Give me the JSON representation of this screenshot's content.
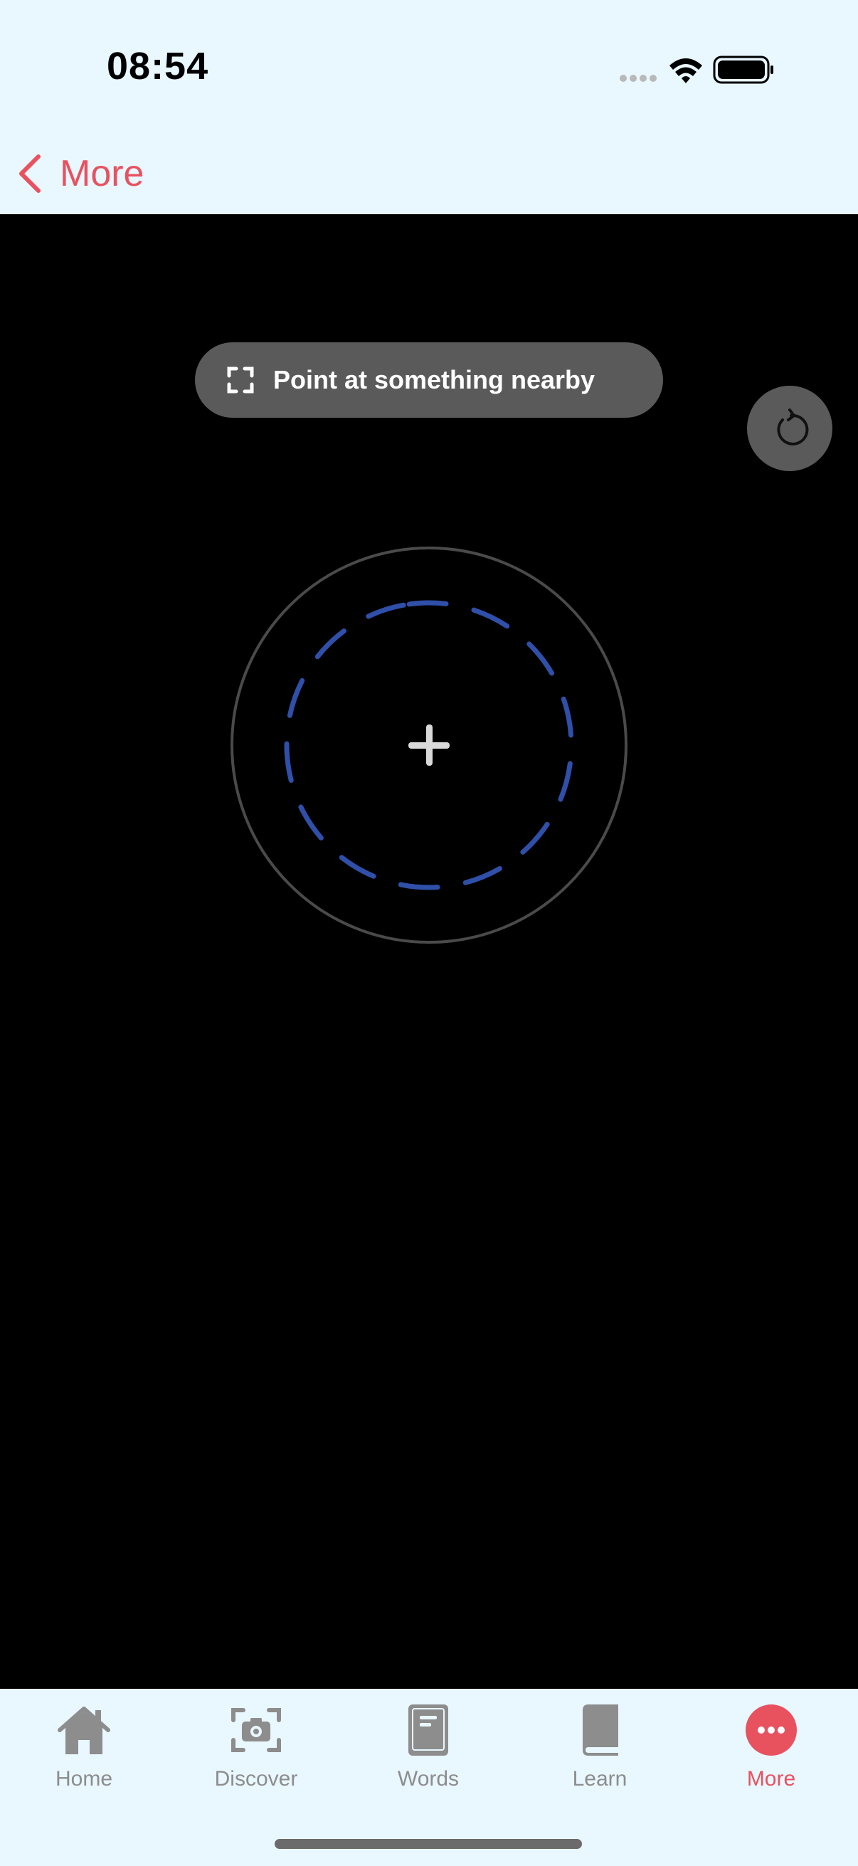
{
  "status_bar": {
    "time": "08:54"
  },
  "nav": {
    "back_label": "More"
  },
  "camera": {
    "hint": "Point at something nearby"
  },
  "tabs": [
    {
      "label": "Home",
      "icon": "home-icon"
    },
    {
      "label": "Discover",
      "icon": "camera-icon"
    },
    {
      "label": "Words",
      "icon": "notebook-icon"
    },
    {
      "label": "Learn",
      "icon": "book-icon"
    },
    {
      "label": "More",
      "icon": "more-icon",
      "active": true
    }
  ],
  "colors": {
    "accent": "#e8525f",
    "reticle_dash": "#2f4fa8",
    "background": "#e9f7ff",
    "inactive": "#8d8d8d"
  }
}
